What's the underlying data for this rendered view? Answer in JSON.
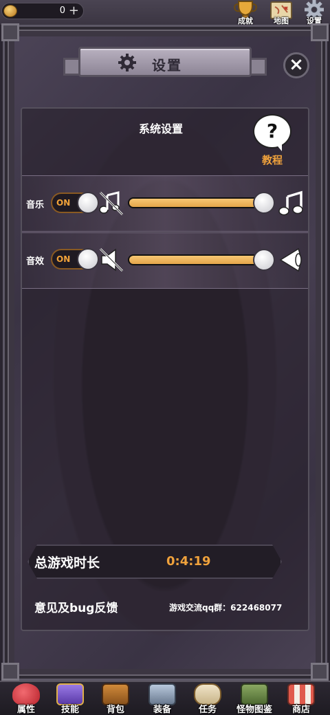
{
  "topbar": {
    "currency_value": "0",
    "currency_add": "+",
    "icons": [
      {
        "name": "trophy-icon",
        "label": "成就"
      },
      {
        "name": "map-icon",
        "label": "地图"
      },
      {
        "name": "gear-icon",
        "label": "设置"
      }
    ]
  },
  "dialog": {
    "title": "设置",
    "close": "×",
    "section_title": "系统设置",
    "tutorial": {
      "icon": "?",
      "label": "教程"
    },
    "music": {
      "label": "音乐",
      "toggle": "ON",
      "volume": 1.0
    },
    "sound": {
      "label": "音效",
      "toggle": "ON",
      "volume": 1.0
    },
    "playtime": {
      "label": "总游戏时长",
      "value": "0:4:19"
    },
    "feedback": "意见及bug反馈",
    "qq_group": "游戏交流qq群：622468077"
  },
  "bottom_nav": [
    {
      "label": "属性",
      "icon": "heart-icon",
      "color": "#e0424a"
    },
    {
      "label": "技能",
      "icon": "spellbook-icon",
      "color": "#7a5bd1"
    },
    {
      "label": "背包",
      "icon": "backpack-icon",
      "color": "#b4742e"
    },
    {
      "label": "装备",
      "icon": "armor-icon",
      "color": "#8fa2b8"
    },
    {
      "label": "任务",
      "icon": "scroll-icon",
      "color": "#d9c9a8"
    },
    {
      "label": "怪物图鉴",
      "icon": "book-icon",
      "color": "#6b8a4a"
    },
    {
      "label": "商店",
      "icon": "shop-icon",
      "color": "#c8483c"
    }
  ],
  "colors": {
    "accent": "#f0a23c",
    "slider_fill": "#f2b85a"
  }
}
